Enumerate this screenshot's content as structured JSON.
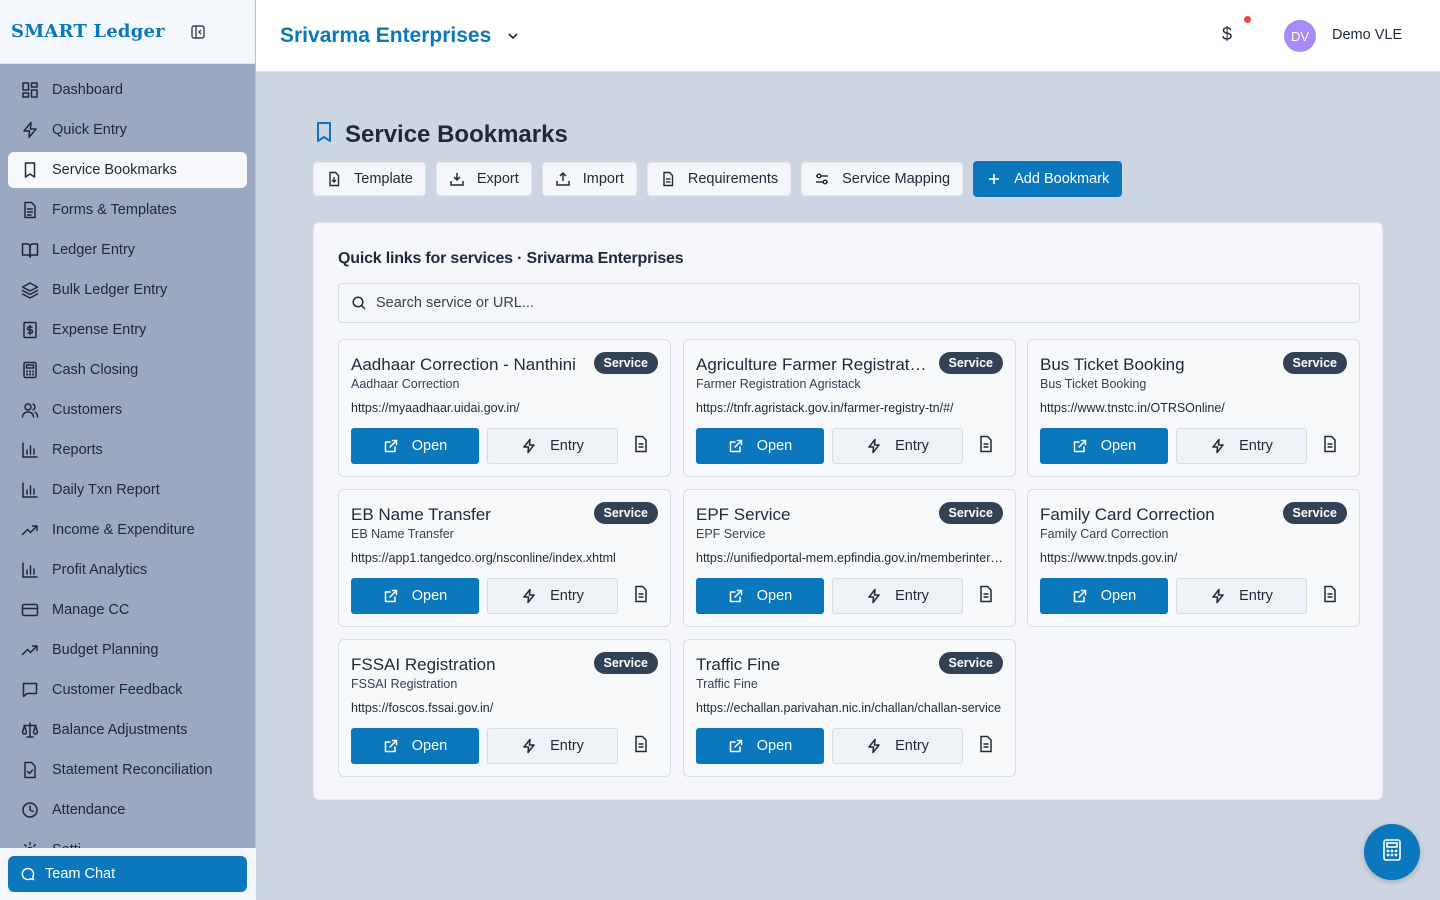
{
  "app": {
    "brand": "SMART Ledger"
  },
  "sidebar": {
    "items": [
      {
        "label": "Dashboard",
        "icon": "dashboard-icon"
      },
      {
        "label": "Quick Entry",
        "icon": "lightning-icon"
      },
      {
        "label": "Service Bookmarks",
        "icon": "bookmark-icon",
        "active": true
      },
      {
        "label": "Forms & Templates",
        "icon": "document-icon"
      },
      {
        "label": "Ledger Entry",
        "icon": "book-icon"
      },
      {
        "label": "Bulk Ledger Entry",
        "icon": "layers-icon"
      },
      {
        "label": "Expense Entry",
        "icon": "dollar-receipt-icon"
      },
      {
        "label": "Cash Closing",
        "icon": "calculator-icon"
      },
      {
        "label": "Customers",
        "icon": "users-icon"
      },
      {
        "label": "Reports",
        "icon": "bar-chart-icon"
      },
      {
        "label": "Daily Txn Report",
        "icon": "bar-chart-icon"
      },
      {
        "label": "Income & Expenditure",
        "icon": "trend-up-icon"
      },
      {
        "label": "Profit Analytics",
        "icon": "bar-chart-icon"
      },
      {
        "label": "Manage CC",
        "icon": "credit-card-icon"
      },
      {
        "label": "Budget Planning",
        "icon": "trend-up-icon"
      },
      {
        "label": "Customer Feedback",
        "icon": "message-square-icon"
      },
      {
        "label": "Balance Adjustments",
        "icon": "scale-icon"
      },
      {
        "label": "Statement Reconciliation",
        "icon": "file-check-icon"
      },
      {
        "label": "Attendance",
        "icon": "clock-icon"
      },
      {
        "label": "Setti",
        "icon": "gear-icon"
      }
    ],
    "team_chat": "Team Chat"
  },
  "topbar": {
    "company": "Srivarma Enterprises",
    "currency_symbol": "$",
    "avatar_initials": "DV",
    "user_name": "Demo VLE"
  },
  "page": {
    "title": "Service Bookmarks",
    "toolbar": {
      "template": "Template",
      "export": "Export",
      "import": "Import",
      "requirements": "Requirements",
      "service_mapping": "Service Mapping",
      "add_bookmark": "Add Bookmark"
    },
    "panel_title": "Quick links for services · Srivarma Enterprises",
    "search_placeholder": "Search service or URL..."
  },
  "bookmarks": [
    {
      "title": "Aadhaar Correction - Nanthini",
      "subtitle": "Aadhaar Correction",
      "url": "https://myaadhaar.uidai.gov.in/",
      "badge": "Service",
      "open": "Open",
      "entry": "Entry"
    },
    {
      "title": "Agriculture Farmer Registration",
      "subtitle": "Farmer Registration Agristack",
      "url": "https://tnfr.agristack.gov.in/farmer-registry-tn/#/",
      "badge": "Service",
      "open": "Open",
      "entry": "Entry"
    },
    {
      "title": "Bus Ticket Booking",
      "subtitle": "Bus Ticket Booking",
      "url": "https://www.tnstc.in/OTRSOnline/",
      "badge": "Service",
      "open": "Open",
      "entry": "Entry"
    },
    {
      "title": "EB Name Transfer",
      "subtitle": "EB Name Transfer",
      "url": "https://app1.tangedco.org/nsconline/index.xhtml",
      "badge": "Service",
      "open": "Open",
      "entry": "Entry"
    },
    {
      "title": "EPF Service",
      "subtitle": "EPF Service",
      "url": "https://unifiedportal-mem.epfindia.gov.in/memberinterface/",
      "badge": "Service",
      "open": "Open",
      "entry": "Entry"
    },
    {
      "title": "Family Card Correction",
      "subtitle": "Family Card Correction",
      "url": "https://www.tnpds.gov.in/",
      "badge": "Service",
      "open": "Open",
      "entry": "Entry"
    },
    {
      "title": "FSSAI Registration",
      "subtitle": "FSSAI Registration",
      "url": "https://foscos.fssai.gov.in/",
      "badge": "Service",
      "open": "Open",
      "entry": "Entry"
    },
    {
      "title": "Traffic Fine",
      "subtitle": "Traffic Fine",
      "url": "https://echallan.parivahan.nic.in/challan/challan-service",
      "badge": "Service",
      "open": "Open",
      "entry": "Entry"
    }
  ],
  "colors": {
    "brand": "#0b78be",
    "badge": "#334155",
    "notification": "#ef4444",
    "avatar": "#a78bfa"
  }
}
